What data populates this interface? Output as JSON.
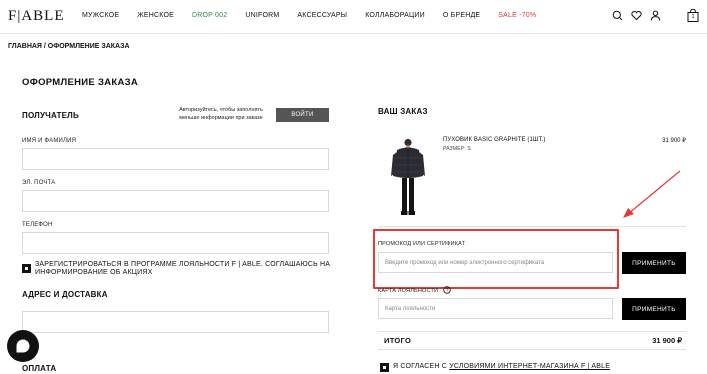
{
  "header": {
    "logo": "F|ABLE",
    "nav": [
      {
        "label": "МУЖСКОЕ",
        "color": "#111111"
      },
      {
        "label": "ЖЕНСКОЕ",
        "color": "#111111"
      },
      {
        "label": "DROP 002",
        "color": "#2e8b3e"
      },
      {
        "label": "UNIFORM",
        "color": "#111111"
      },
      {
        "label": "АКСЕССУАРЫ",
        "color": "#111111"
      },
      {
        "label": "КОЛЛАБОРАЦИИ",
        "color": "#111111"
      },
      {
        "label": "О БРЕНДЕ",
        "color": "#111111"
      },
      {
        "label": "SALE -70%",
        "color": "#e53935"
      }
    ],
    "icons": [
      "search-icon",
      "heart-icon",
      "user-icon",
      "bag-icon"
    ],
    "cart_count": "1"
  },
  "breadcrumb": "ГЛАВНАЯ / ОФОРМЛЕНИЕ ЗАКАЗА",
  "page_title": "ОФОРМЛЕНИЕ ЗАКАЗА",
  "recipient": {
    "title": "ПОЛУЧАТЕЛЬ",
    "auth_hint": "Авторизуйтесь, чтобы заполнять меньше информации при заказе",
    "login_label": "ВОЙТИ",
    "fields": [
      {
        "label": "ИМЯ И ФАМИЛИЯ",
        "value": ""
      },
      {
        "label": "ЭЛ. ПОЧТА",
        "value": ""
      },
      {
        "label": "ТЕЛЕФОН",
        "value": ""
      }
    ],
    "loyalty_checkbox_label": "ЗАРЕГИСТРИРОВАТЬСЯ В ПРОГРАММЕ ЛОЯЛЬНОСТИ F | ABLE. СОГЛАШАЮСЬ НА ИНФОРМИРОВАНИЕ ОБ АКЦИЯХ",
    "loyalty_checked": true
  },
  "delivery": {
    "title": "АДРЕС И ДОСТАВКА",
    "address_value": ""
  },
  "payment": {
    "title": "ОПЛАТА"
  },
  "order": {
    "title": "ВАШ ЗАКАЗ",
    "item": {
      "name": "ПУХОВИК BASIC GRAPHITE (1ШТ.)",
      "size": "РАЗМЕР: S",
      "price": "31 900 ₽"
    },
    "promo": {
      "label": "ПРОМОКОД ИЛИ СЕРТИФИКАТ",
      "placeholder": "Введите промокод или номер электронного сертификата",
      "apply_label": "ПРИМЕНИТЬ"
    },
    "loyalty_card": {
      "label": "КАРТА ЛОЯЛЬНОСТИ",
      "placeholder": "Карта лояльности",
      "apply_label": "ПРИМЕНИТЬ"
    },
    "total_label": "ИТОГО",
    "total_value": "31 900 ₽",
    "agree_prefix": "Я СОГЛАСЕН С ",
    "agree_link": "УСЛОВИЯМИ ИНТЕРНЕТ-МАГАЗИНА F | ABLE",
    "agree_checked": true
  },
  "colors": {
    "accent_red": "#e53935",
    "drop_green": "#2e8b3e",
    "button_dark": "#000000",
    "login_gray": "#555555"
  }
}
